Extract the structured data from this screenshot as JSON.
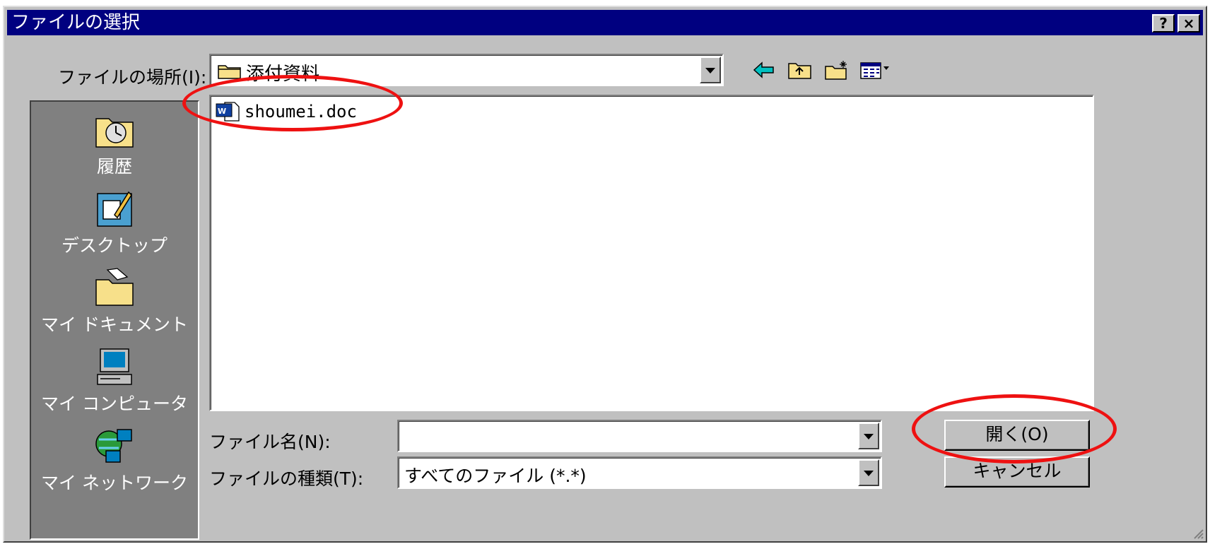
{
  "window": {
    "title": "ファイルの選択",
    "help_label": "?",
    "close_label": "×"
  },
  "location": {
    "label": "ファイルの場所(I):",
    "current": "添付資料"
  },
  "toolbar": {
    "icons": [
      "back-arrow-icon",
      "up-folder-icon",
      "new-folder-icon",
      "view-menu-icon"
    ]
  },
  "places": [
    {
      "label": "履歴",
      "icon": "history-folder-icon"
    },
    {
      "label": "デスクトップ",
      "icon": "desktop-icon"
    },
    {
      "label": "マイ ドキュメント",
      "icon": "my-documents-icon"
    },
    {
      "label": "マイ コンピュータ",
      "icon": "my-computer-icon"
    },
    {
      "label": "マイ ネットワーク",
      "icon": "network-icon"
    }
  ],
  "files": [
    {
      "name": "shoumei.doc",
      "icon": "word-document-icon"
    }
  ],
  "filename": {
    "label": "ファイル名(N):",
    "value": ""
  },
  "filetype": {
    "label": "ファイルの種類(T):",
    "value": "すべてのファイル (*.*)"
  },
  "buttons": {
    "open": "開く(O)",
    "cancel": "キャンセル"
  },
  "colors": {
    "titlebar": "#000080",
    "dialog": "#c0c0c0",
    "places_bg": "#808080",
    "highlight": "#ee1111"
  }
}
